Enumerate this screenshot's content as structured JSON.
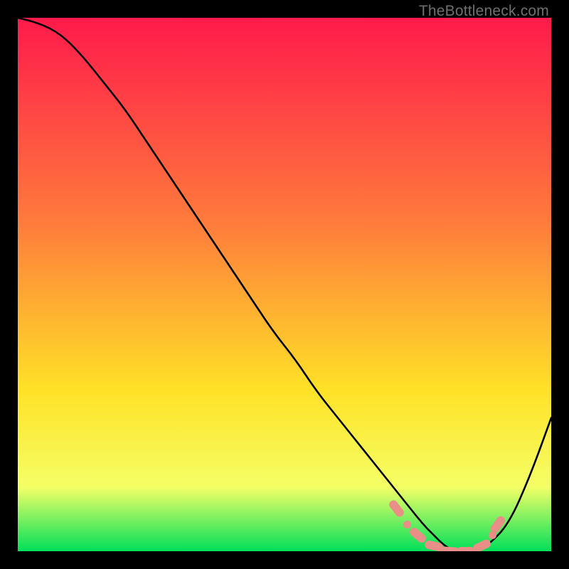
{
  "watermark": "TheBottleneck.com",
  "colors": {
    "gradient_top": "#ff1a4b",
    "gradient_mid1": "#ff7a3c",
    "gradient_mid2": "#ffe227",
    "gradient_mid3": "#f4ff66",
    "gradient_bottom": "#00e05a",
    "curve": "#000000",
    "marker_fill": "#e98f88",
    "marker_stroke": "#b55a55",
    "frame": "#000000"
  },
  "chart_data": {
    "type": "line",
    "title": "",
    "xlabel": "",
    "ylabel": "",
    "xlim": [
      0,
      100
    ],
    "ylim": [
      0,
      100
    ],
    "grid": false,
    "legend": false,
    "background": "vertical-gradient red→orange→yellow→green (bottleneck heatmap)",
    "series": [
      {
        "name": "bottleneck-curve",
        "x": [
          0,
          4,
          8,
          12,
          16,
          20,
          24,
          28,
          32,
          36,
          40,
          44,
          48,
          52,
          56,
          60,
          64,
          68,
          72,
          76,
          78,
          80,
          82,
          84,
          86,
          88,
          92,
          96,
          100
        ],
        "y": [
          100,
          99,
          97,
          93,
          88,
          83,
          77,
          71,
          65,
          59,
          53,
          47,
          41,
          36,
          30,
          25,
          20,
          15,
          10,
          5,
          3,
          1,
          0,
          0,
          0,
          1,
          5,
          14,
          25
        ]
      }
    ],
    "markers": {
      "name": "highlighted-segment",
      "points": [
        {
          "x": 71,
          "y": 8,
          "shape": "pill",
          "angle": 52
        },
        {
          "x": 73,
          "y": 5,
          "shape": "dot"
        },
        {
          "x": 75,
          "y": 3,
          "shape": "pill",
          "angle": 40
        },
        {
          "x": 78,
          "y": 1,
          "shape": "pill",
          "angle": 12
        },
        {
          "x": 81,
          "y": 0,
          "shape": "pill",
          "angle": 4
        },
        {
          "x": 84,
          "y": 0,
          "shape": "pill",
          "angle": 0
        },
        {
          "x": 87,
          "y": 1,
          "shape": "pill",
          "angle": -25
        },
        {
          "x": 89,
          "y": 3,
          "shape": "dot"
        },
        {
          "x": 90,
          "y": 5,
          "shape": "pill",
          "angle": -55
        }
      ]
    }
  }
}
